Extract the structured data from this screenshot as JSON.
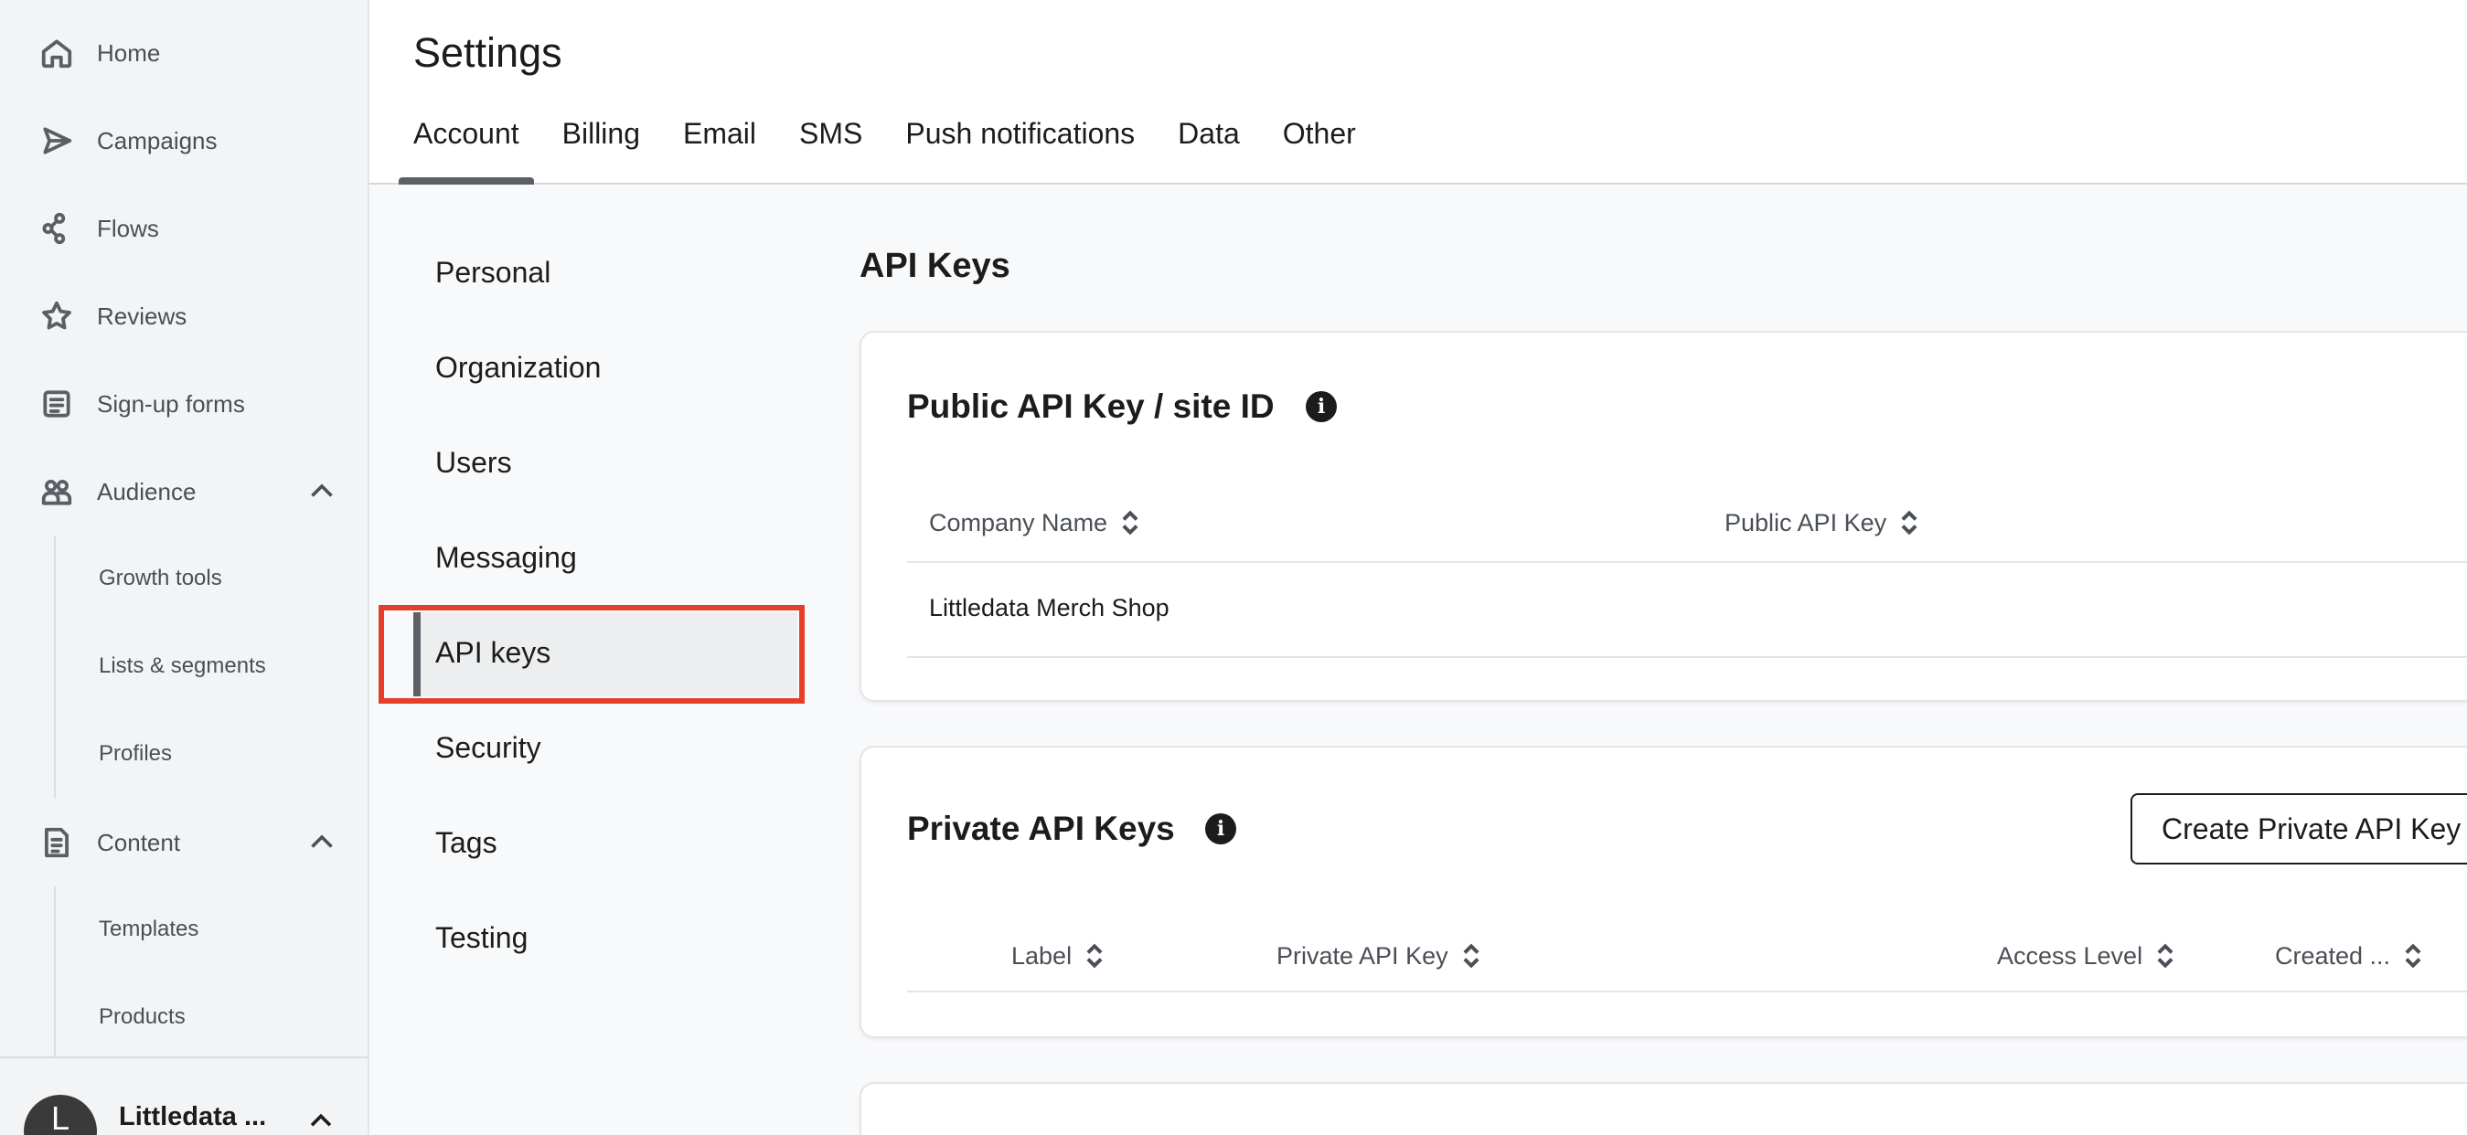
{
  "nav": {
    "items": [
      {
        "label": "Home",
        "icon": "home-icon"
      },
      {
        "label": "Campaigns",
        "icon": "send-icon"
      },
      {
        "label": "Flows",
        "icon": "flows-icon"
      },
      {
        "label": "Reviews",
        "icon": "star-icon"
      },
      {
        "label": "Sign-up forms",
        "icon": "form-icon"
      },
      {
        "label": "Audience",
        "icon": "users-icon"
      },
      {
        "label": "Content",
        "icon": "content-icon"
      }
    ],
    "audience_sub": [
      "Growth tools",
      "Lists & segments",
      "Profiles"
    ],
    "content_sub": [
      "Templates",
      "Products"
    ],
    "footer": {
      "avatar_letter": "L",
      "org_name": "Littledata ..."
    }
  },
  "header": {
    "title": "Settings",
    "tabs": [
      "Account",
      "Billing",
      "Email",
      "SMS",
      "Push notifications",
      "Data",
      "Other"
    ],
    "active_tab": "Account"
  },
  "subnav": {
    "items": [
      "Personal",
      "Organization",
      "Users",
      "Messaging",
      "API keys",
      "Security",
      "Tags",
      "Testing"
    ],
    "active": "API keys"
  },
  "main": {
    "section_title": "API Keys",
    "public_card": {
      "title": "Public API Key / site ID",
      "columns": [
        "Company Name",
        "Public API Key"
      ],
      "rows": [
        [
          "Littledata Merch Shop",
          ""
        ]
      ]
    },
    "private_card": {
      "title": "Private API Keys",
      "create_button": "Create Private API Key",
      "columns": [
        "Label",
        "Private API Key",
        "Access Level",
        "Created ..."
      ]
    }
  },
  "colors": {
    "highlight": "#e53f2a",
    "accent": "#5c5f65"
  }
}
